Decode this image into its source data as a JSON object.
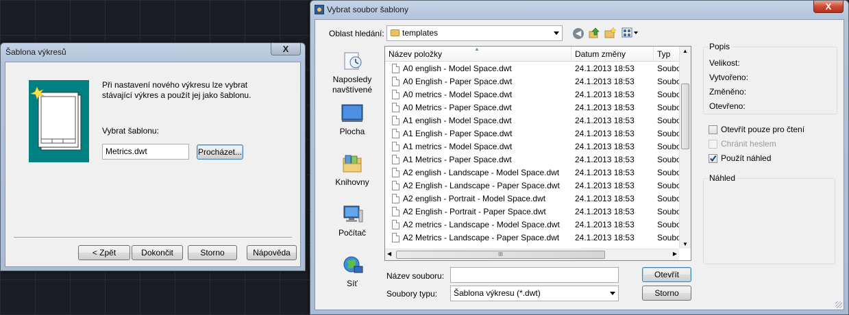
{
  "wizard": {
    "title": "Šablona výkresů",
    "close": "X",
    "description": "Při nastavení nového výkresu lze vybrat stávající výkres a použít jej jako šablonu.",
    "select_label": "Vybrat šablonu:",
    "template_value": "Metrics.dwt",
    "browse_button": "Procházet...",
    "buttons": {
      "back": "< Zpět",
      "finish": "Dokončit",
      "cancel": "Storno",
      "help": "Nápověda"
    }
  },
  "file_dialog": {
    "title": "Vybrat soubor šablony",
    "close": "X",
    "lookin_label": "Oblast hledání:",
    "lookin_value": "templates",
    "places": [
      "Naposledy navštívené",
      "Plocha",
      "Knihovny",
      "Počítač",
      "Síť"
    ],
    "columns": {
      "name": "Název položky",
      "date": "Datum změny",
      "type": "Typ"
    },
    "files": [
      {
        "name": "A0 english - Model Space.dwt",
        "date": "24.1.2013 18:53",
        "type": "Soubo"
      },
      {
        "name": "A0 English - Paper Space.dwt",
        "date": "24.1.2013 18:53",
        "type": "Soubo"
      },
      {
        "name": "A0 metrics - Model Space.dwt",
        "date": "24.1.2013 18:53",
        "type": "Soubo"
      },
      {
        "name": "A0 Metrics - Paper Space.dwt",
        "date": "24.1.2013 18:53",
        "type": "Soubo"
      },
      {
        "name": "A1 english - Model Space.dwt",
        "date": "24.1.2013 18:53",
        "type": "Soubo"
      },
      {
        "name": "A1 English - Paper Space.dwt",
        "date": "24.1.2013 18:53",
        "type": "Soubo"
      },
      {
        "name": "A1 metrics - Model Space.dwt",
        "date": "24.1.2013 18:53",
        "type": "Soubo"
      },
      {
        "name": "A1 Metrics - Paper Space.dwt",
        "date": "24.1.2013 18:53",
        "type": "Soubo"
      },
      {
        "name": "A2 english - Landscape - Model Space.dwt",
        "date": "24.1.2013 18:53",
        "type": "Soubo"
      },
      {
        "name": "A2 English - Landscape - Paper Space.dwt",
        "date": "24.1.2013 18:53",
        "type": "Soubo"
      },
      {
        "name": "A2 english - Portrait - Model Space.dwt",
        "date": "24.1.2013 18:53",
        "type": "Soubo"
      },
      {
        "name": "A2 English - Portrait - Paper Space.dwt",
        "date": "24.1.2013 18:53",
        "type": "Soubo"
      },
      {
        "name": "A2 metrics - Landscape - Model Space.dwt",
        "date": "24.1.2013 18:53",
        "type": "Soubo"
      },
      {
        "name": "A2 Metrics - Landscape - Paper Space.dwt",
        "date": "24.1.2013 18:53",
        "type": "Soubo"
      }
    ],
    "hscroll_grip": "III",
    "filename_label": "Název souboru:",
    "filename_value": "",
    "filetype_label": "Soubory typu:",
    "filetype_value": "Šablona výkresu (*.dwt)",
    "open_button": "Otevřít",
    "cancel_button": "Storno",
    "info": {
      "title": "Popis",
      "size": "Velikost:",
      "created": "Vytvořeno:",
      "modified": "Změněno:",
      "opened": "Otevřeno:"
    },
    "options": [
      {
        "label": "Otevřít pouze pro čtení",
        "checked": false,
        "enabled": true
      },
      {
        "label": "Chránit heslem",
        "checked": false,
        "enabled": false
      },
      {
        "label": "Použít náhled",
        "checked": true,
        "enabled": true
      }
    ],
    "preview_title": "Náhled"
  },
  "colors": {
    "teal_panel": "#008080",
    "check_mark": "#1a3f73"
  }
}
